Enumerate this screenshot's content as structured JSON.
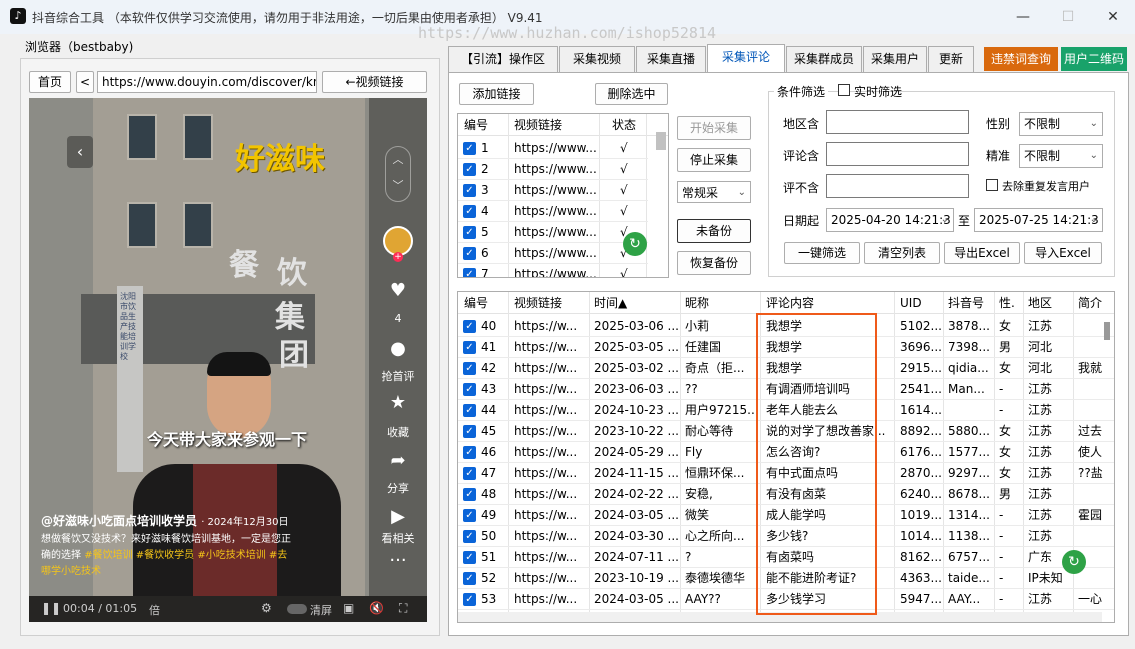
{
  "app": {
    "title": "抖音综合工具 （本软件仅供学习交流使用，请勿用于非法用途，一切后果由使用者承担）  V9.41",
    "watermark": "https://www.huzhan.com/ishop52814",
    "minimize": "—",
    "maximize": "☐",
    "close": "✕"
  },
  "browser": {
    "label": "浏览器（bestbaby)",
    "home": "首页",
    "back": "<",
    "url": "https://www.douyin.com/discover/knd",
    "video_link": "←视频链接"
  },
  "video": {
    "sign_gold": "好滋味",
    "sign_cn": [
      "餐",
      "饮",
      "集",
      "团"
    ],
    "sign_vertical": "沈阳市饮品生产技能培训学校",
    "like_count": "4",
    "sidebar": [
      "抢首评",
      "收藏",
      "分享",
      "看相关"
    ],
    "subtitle": "今天带大家来参观一下",
    "author": "@好滋味小吃面点培训收学员",
    "date": "· 2024年12月30日",
    "desc": "想做餐饮又没技术？来好滋味餐饮培训基地，一定是您正确的选择",
    "tags": [
      "#餐饮培训",
      "#餐饮收学员",
      "#小吃技术培训",
      "#去哪学小吃技术"
    ],
    "time": "00:04 / 01:05",
    "ctrl_speed": "倍",
    "ctrl_clear": "清屏"
  },
  "tabs": [
    "【引流】操作区",
    "采集视频",
    "采集直播",
    "采集评论",
    "采集群成员",
    "采集用户",
    "更新"
  ],
  "special_buttons": {
    "banned": "违禁词查询",
    "qrcode": "用户二维码"
  },
  "links": {
    "add": "添加链接",
    "delete": "删除选中",
    "columns": [
      "编号",
      "视频链接",
      "状态"
    ],
    "rows": [
      {
        "no": "1",
        "url": "https://www...",
        "status": "√"
      },
      {
        "no": "2",
        "url": "https://www...",
        "status": "√"
      },
      {
        "no": "3",
        "url": "https://www...",
        "status": "√"
      },
      {
        "no": "4",
        "url": "https://www...",
        "status": "√"
      },
      {
        "no": "5",
        "url": "https://www...",
        "status": "√"
      },
      {
        "no": "6",
        "url": "https://www...",
        "status": "√"
      },
      {
        "no": "7",
        "url": "https://www...",
        "status": "√"
      }
    ]
  },
  "controls": {
    "start": "开始采集",
    "stop": "停止采集",
    "mode": "常规采",
    "backup": "未备份",
    "restore": "恢复备份"
  },
  "filter": {
    "title": "条件筛选",
    "realtime": "实时筛选",
    "region": "地区含",
    "comment": "评论含",
    "exclude": "评不含",
    "gender": "性别",
    "gender_value": "不限制",
    "precise": "精准",
    "precise_value": "不限制",
    "dedupe": "去除重复发言用户",
    "date_from_lbl": "日期起",
    "date_from": "2025-04-20 14:21:3",
    "date_to_lbl": "至",
    "date_to": "2025-07-25 14:21:3",
    "btn_filter": "一键筛选",
    "btn_clear": "清空列表",
    "btn_export": "导出Excel",
    "btn_import": "导入Excel"
  },
  "comments": {
    "columns": [
      "编号",
      "视频链接",
      "时间▲",
      "昵称",
      "评论内容",
      "UID",
      "抖音号",
      "性.",
      "地区",
      "简介"
    ],
    "rows": [
      {
        "no": "40",
        "url": "https://w...",
        "time": "2025-03-06 ...",
        "nick": "小莉",
        "content": "我想学",
        "uid": "5102...",
        "dy": "3878...",
        "sex": "女",
        "region": "江苏",
        "intro": ""
      },
      {
        "no": "41",
        "url": "https://w...",
        "time": "2025-03-05 ...",
        "nick": "任建国",
        "content": "我想学",
        "uid": "3696...",
        "dy": "7398...",
        "sex": "男",
        "region": "河北",
        "intro": ""
      },
      {
        "no": "42",
        "url": "https://w...",
        "time": "2025-03-02 ...",
        "nick": "奇点（拒...",
        "content": "我想学",
        "uid": "2915...",
        "dy": "qidia...",
        "sex": "女",
        "region": "河北",
        "intro": "我就"
      },
      {
        "no": "43",
        "url": "https://w...",
        "time": "2023-06-03 ...",
        "nick": "??",
        "content": "有调酒师培训吗",
        "uid": "2541...",
        "dy": "Man...",
        "sex": "-",
        "region": "江苏",
        "intro": ""
      },
      {
        "no": "44",
        "url": "https://w...",
        "time": "2024-10-23 ...",
        "nick": "用户97215...",
        "content": "老年人能去么",
        "uid": "1614...",
        "dy": "",
        "sex": "-",
        "region": "江苏",
        "intro": ""
      },
      {
        "no": "45",
        "url": "https://w...",
        "time": "2023-10-22 ...",
        "nick": "耐心等待",
        "content": "说的对学了想改善家...",
        "uid": "8892...",
        "dy": "5880...",
        "sex": "女",
        "region": "江苏",
        "intro": "过去"
      },
      {
        "no": "46",
        "url": "https://w...",
        "time": "2024-05-29 ...",
        "nick": "Fly",
        "content": "怎么咨询?",
        "uid": "6176...",
        "dy": "1577...",
        "sex": "女",
        "region": "江苏",
        "intro": "使人"
      },
      {
        "no": "47",
        "url": "https://w...",
        "time": "2024-11-15 ...",
        "nick": "恒鼎环保...",
        "content": "有中式面点吗",
        "uid": "2870...",
        "dy": "9297...",
        "sex": "女",
        "region": "江苏",
        "intro": "??盐"
      },
      {
        "no": "48",
        "url": "https://w...",
        "time": "2024-02-22 ...",
        "nick": "安稳,",
        "content": "有没有卤菜",
        "uid": "6240...",
        "dy": "8678...",
        "sex": "男",
        "region": "江苏",
        "intro": ""
      },
      {
        "no": "49",
        "url": "https://w...",
        "time": "2024-03-05 ...",
        "nick": "微笑",
        "content": "成人能学吗",
        "uid": "1019...",
        "dy": "1314...",
        "sex": "-",
        "region": "江苏",
        "intro": "霍园"
      },
      {
        "no": "50",
        "url": "https://w...",
        "time": "2024-03-30 ...",
        "nick": "心之所向...",
        "content": "多少钱?",
        "uid": "1014...",
        "dy": "1138...",
        "sex": "-",
        "region": "江苏",
        "intro": ""
      },
      {
        "no": "51",
        "url": "https://w...",
        "time": "2024-07-11 ...",
        "nick": "?",
        "content": "有卤菜吗",
        "uid": "8162...",
        "dy": "6757...",
        "sex": "-",
        "region": "广东",
        "intro": ""
      },
      {
        "no": "52",
        "url": "https://w...",
        "time": "2023-10-19 ...",
        "nick": "泰德埃德华",
        "content": "能不能进阶考证?",
        "uid": "4363...",
        "dy": "taide...",
        "sex": "-",
        "region": "IP未知",
        "intro": ""
      },
      {
        "no": "53",
        "url": "https://w...",
        "time": "2024-03-05 ...",
        "nick": "AAY??",
        "content": "多少钱学习",
        "uid": "5947...",
        "dy": "AAY...",
        "sex": "-",
        "region": "江苏",
        "intro": "一心"
      }
    ]
  }
}
